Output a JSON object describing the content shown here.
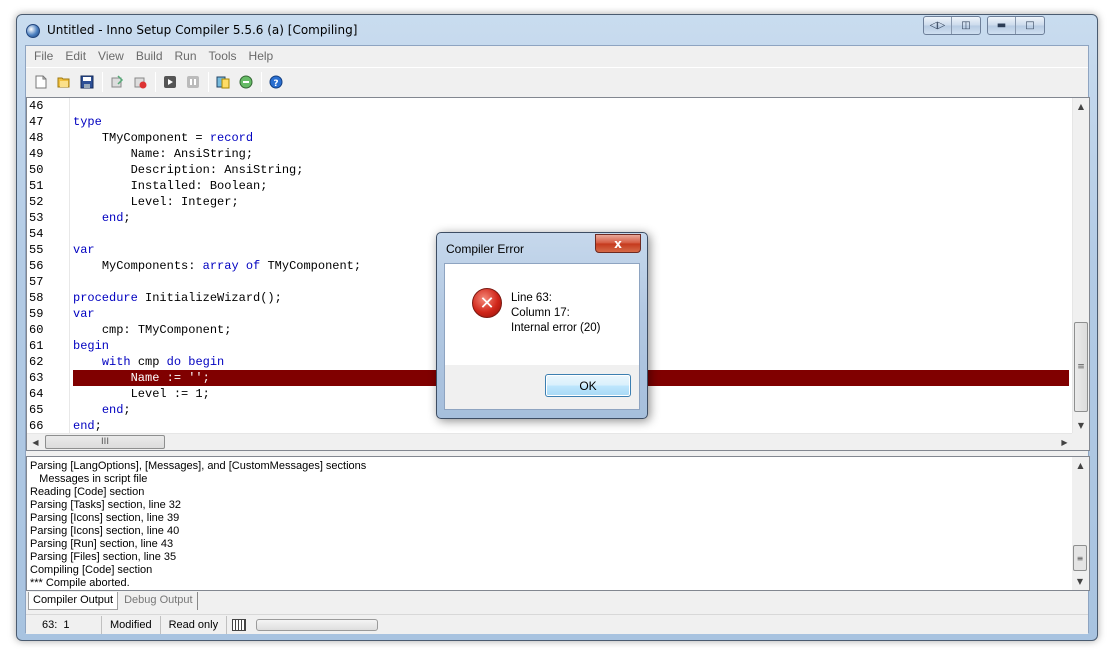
{
  "window": {
    "title": "Untitled - Inno Setup Compiler 5.5.6 (a)  [Compiling]",
    "caption_buttons_left": [
      "restore-icon",
      "pin-icon"
    ],
    "caption_buttons_right": [
      "minimize-icon",
      "maximize-icon"
    ]
  },
  "menu": [
    "File",
    "Edit",
    "View",
    "Build",
    "Run",
    "Tools",
    "Help"
  ],
  "toolbar": [
    "new-icon",
    "open-icon",
    "save-icon",
    "sep",
    "compile-icon",
    "stop-compile-icon",
    "sep",
    "run-icon",
    "pause-icon",
    "sep",
    "setup-icon",
    "uninstall-icon",
    "sep",
    "help-icon"
  ],
  "editor": {
    "lines": [
      {
        "num": "46",
        "text": ""
      },
      {
        "num": "47",
        "text": "type"
      },
      {
        "num": "48",
        "text": "    TMyComponent = record"
      },
      {
        "num": "49",
        "text": "        Name: AnsiString;"
      },
      {
        "num": "50",
        "text": "        Description: AnsiString;"
      },
      {
        "num": "51",
        "text": "        Installed: Boolean;"
      },
      {
        "num": "52",
        "text": "        Level: Integer;"
      },
      {
        "num": "53",
        "text": "    end;"
      },
      {
        "num": "54",
        "text": ""
      },
      {
        "num": "55",
        "text": "var"
      },
      {
        "num": "56",
        "text": "    MyComponents: array of TMyComponent;"
      },
      {
        "num": "57",
        "text": ""
      },
      {
        "num": "58",
        "text": "procedure InitializeWizard();"
      },
      {
        "num": "59",
        "text": "var"
      },
      {
        "num": "60",
        "text": "    cmp: TMyComponent;"
      },
      {
        "num": "61",
        "text": "begin"
      },
      {
        "num": "62",
        "text": "    with cmp do begin"
      },
      {
        "num": "63",
        "text": "        Name := '';"
      },
      {
        "num": "64",
        "text": "        Level := 1;"
      },
      {
        "num": "65",
        "text": "    end;"
      },
      {
        "num": "66",
        "text": "end;"
      }
    ],
    "highlighted_line": "63",
    "hscroll_thumb_label": "III",
    "vscroll_thumb_label": "≡"
  },
  "output": {
    "lines": [
      "Parsing [LangOptions], [Messages], and [CustomMessages] sections",
      "   Messages in script file",
      "Reading [Code] section",
      "Parsing [Tasks] section, line 32",
      "Parsing [Icons] section, line 39",
      "Parsing [Icons] section, line 40",
      "Parsing [Run] section, line 43",
      "Parsing [Files] section, line 35",
      "Compiling [Code] section",
      "*** Compile aborted."
    ]
  },
  "tabs": {
    "compiler_output": "Compiler Output",
    "debug_output": "Debug Output"
  },
  "status": {
    "position": "63:  1",
    "modified": "Modified",
    "read_only": "Read only",
    "progress": 0
  },
  "dialog": {
    "title": "Compiler Error",
    "close_label": "x",
    "line1": "Line 63:",
    "line2": "Column 17:",
    "line3": "Internal error (20)",
    "ok_label": "OK",
    "icon": "error-icon"
  },
  "colors": {
    "keyword": "#0000c0",
    "highlight_bg": "#800000",
    "highlight_fg": "#ffffff"
  }
}
